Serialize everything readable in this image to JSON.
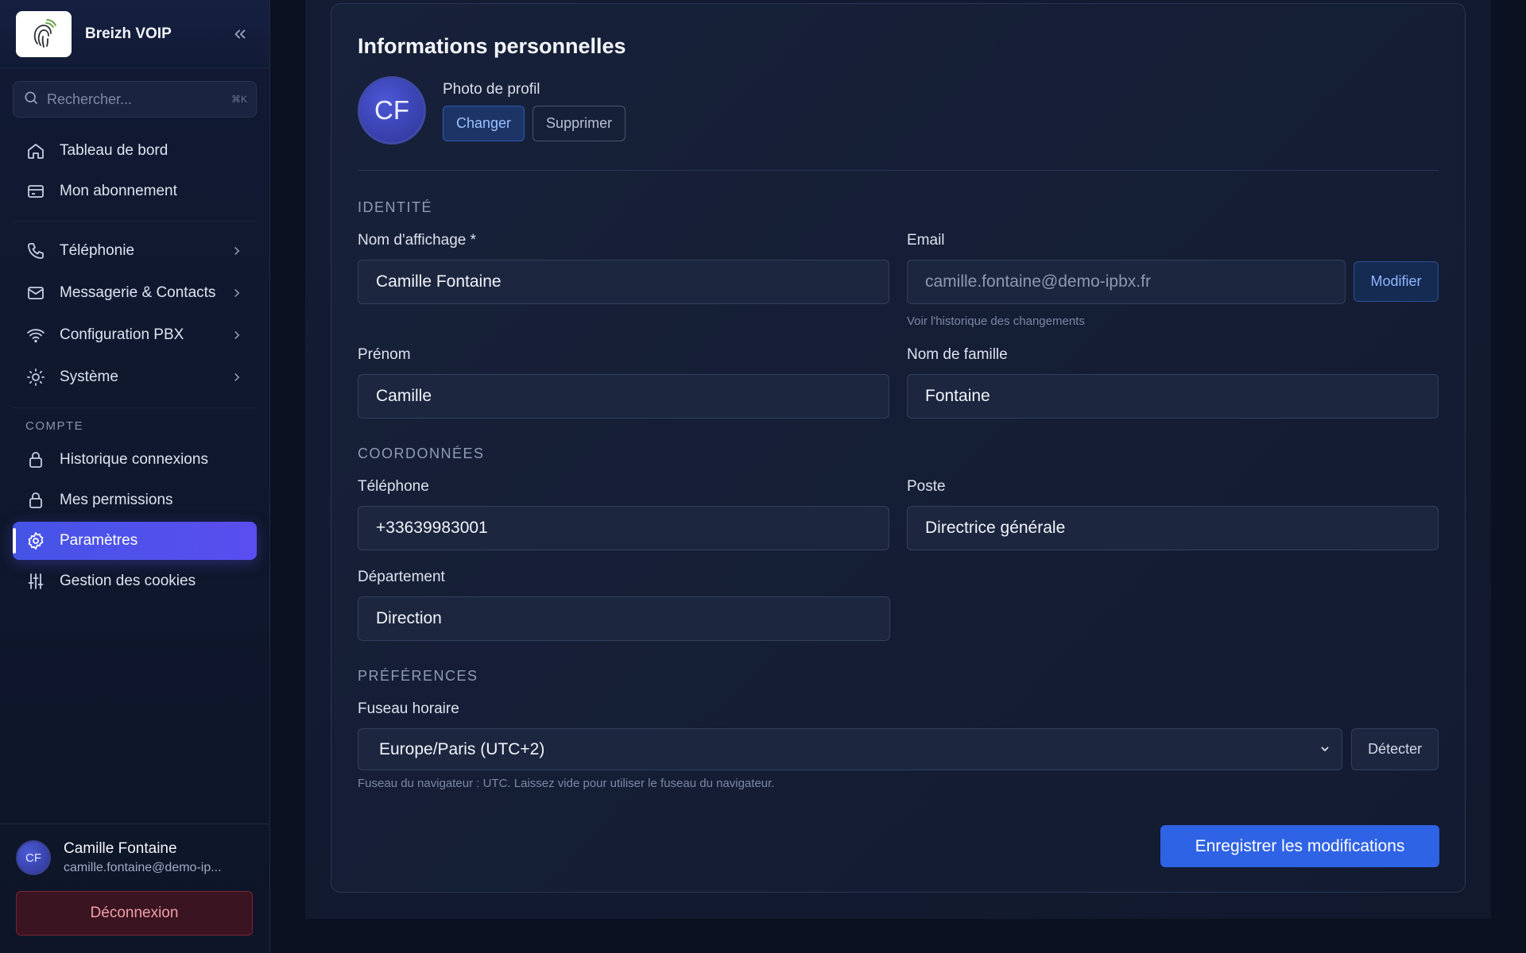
{
  "brand": {
    "name": "Breizh VOIP",
    "logo_icon": "fingerprint-logo",
    "collapse_icon": "chevrons-left-icon"
  },
  "search": {
    "placeholder": "Rechercher...",
    "shortcut": "⌘K"
  },
  "nav": {
    "group1": [
      {
        "label": "Tableau de bord",
        "icon": "home-icon"
      },
      {
        "label": "Mon abonnement",
        "icon": "credit-card-icon"
      }
    ],
    "group2": [
      {
        "label": "Téléphonie",
        "icon": "phone-icon"
      },
      {
        "label": "Messagerie & Contacts",
        "icon": "mail-icon"
      },
      {
        "label": "Configuration PBX",
        "icon": "wifi-icon"
      },
      {
        "label": "Système",
        "icon": "sun-icon"
      }
    ],
    "account_section": "COMPTE",
    "account": [
      {
        "label": "Historique connexions",
        "icon": "lock-icon"
      },
      {
        "label": "Mes permissions",
        "icon": "lock-icon"
      },
      {
        "label": "Paramètres",
        "icon": "settings-icon",
        "active": true
      },
      {
        "label": "Gestion des cookies",
        "icon": "sliders-icon"
      }
    ]
  },
  "user": {
    "initials": "CF",
    "name": "Camille Fontaine",
    "email": "camille.fontaine@demo-ip...",
    "logout_label": "Déconnexion"
  },
  "page": {
    "title": "Informations personnelles",
    "avatar_initials": "CF",
    "photo_label": "Photo de profil",
    "change_label": "Changer",
    "remove_label": "Supprimer"
  },
  "identity": {
    "section": "IDENTITÉ",
    "display_name_label": "Nom d'affichage *",
    "display_name_value": "Camille Fontaine",
    "email_label": "Email",
    "email_value": "camille.fontaine@demo-ipbx.fr",
    "modify_label": "Modifier",
    "history_hint": "Voir l'historique des changements",
    "first_name_label": "Prénom",
    "first_name_value": "Camille",
    "last_name_label": "Nom de famille",
    "last_name_value": "Fontaine"
  },
  "contact": {
    "section": "COORDONNÉES",
    "phone_label": "Téléphone",
    "phone_value": "+33639983001",
    "position_label": "Poste",
    "position_value": "Directrice générale",
    "department_label": "Département",
    "department_value": "Direction"
  },
  "preferences": {
    "section": "PRÉFÉRENCES",
    "timezone_label": "Fuseau horaire",
    "timezone_value": "Europe/Paris (UTC+2)",
    "detect_label": "Détecter",
    "timezone_hint": "Fuseau du navigateur : UTC. Laissez vide pour utiliser le fuseau du navigateur."
  },
  "save_label": "Enregistrer les modifications",
  "colors": {
    "accent": "#2f63e5",
    "active_nav": "#4f52ec",
    "danger": "#7a2434"
  }
}
